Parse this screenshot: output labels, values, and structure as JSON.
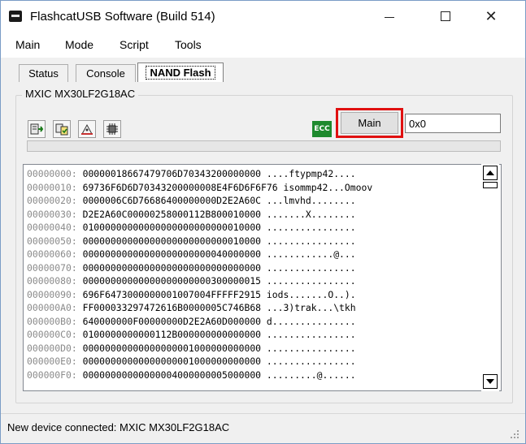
{
  "window": {
    "title": "FlashcatUSB Software (Build 514)",
    "minimize_label": "Minimize",
    "maximize_label": "Maximize",
    "close_label": "Close"
  },
  "menu": {
    "items": [
      "Main",
      "Mode",
      "Script",
      "Tools"
    ]
  },
  "tabs": [
    {
      "label": "Status",
      "active": false
    },
    {
      "label": "Console",
      "active": false
    },
    {
      "label": "NAND Flash",
      "active": true
    }
  ],
  "group": {
    "label": "MXIC MX30LF2G18AC"
  },
  "toolbar": {
    "icons": [
      "read-icon",
      "verify-icon",
      "erase-icon",
      "chip-icon"
    ],
    "ecc_label": "ECC",
    "main_button_label": "Main",
    "address_value": "0x0",
    "highlight_color": "#e01010"
  },
  "hex": {
    "rows": [
      {
        "addr": "00000000:",
        "bytes": "0000001866747970 6D70343200000000",
        "ascii": "....ftypmp42...."
      },
      {
        "addr": "00000010:",
        "bytes": "69736F6D6D703432 00000008E4F6D6F6F76",
        "ascii": "isommp42...Omoov"
      },
      {
        "addr": "00000020:",
        "bytes": "0000006C6D766864 00000000D2E2A60C",
        "ascii": "...lmvhd........"
      },
      {
        "addr": "00000030:",
        "bytes": "D2E2A60C00000258 000112B800010000",
        "ascii": ".......X........"
      },
      {
        "addr": "00000040:",
        "bytes": "0100000000000000 0000000000010000",
        "ascii": "................"
      },
      {
        "addr": "00000050:",
        "bytes": "0000000000000000 0000000000010000",
        "ascii": "................"
      },
      {
        "addr": "00000060:",
        "bytes": "0000000000000000 0000000040000000",
        "ascii": "............@..."
      },
      {
        "addr": "00000070:",
        "bytes": "0000000000000000 0000000000000000",
        "ascii": "................"
      },
      {
        "addr": "00000080:",
        "bytes": "0000000000000000 0000000300000015",
        "ascii": "................"
      },
      {
        "addr": "00000090:",
        "bytes": "696F647300000000 1007004FFFFF2915",
        "ascii": "iods.......O..)."
      },
      {
        "addr": "000000A0:",
        "bytes": "FF00003329747261 6B0000005C746B68",
        "ascii": "...3)trak...\\tkh"
      },
      {
        "addr": "000000B0:",
        "bytes": "640000000F000000 00D2E2A60D000000",
        "ascii": "d..............."
      },
      {
        "addr": "000000C0:",
        "bytes": "0100000000000112 B000000000000000",
        "ascii": "................"
      },
      {
        "addr": "000000D0:",
        "bytes": "0000000000000000 0001000000000000",
        "ascii": "................"
      },
      {
        "addr": "000000E0:",
        "bytes": "0000000000000000 0001000000000000",
        "ascii": "................"
      },
      {
        "addr": "000000F0:",
        "bytes": "0000000000000000 4000000005000000",
        "ascii": ".........@......"
      }
    ]
  },
  "status": {
    "text": "New device connected: MXIC MX30LF2G18AC"
  }
}
